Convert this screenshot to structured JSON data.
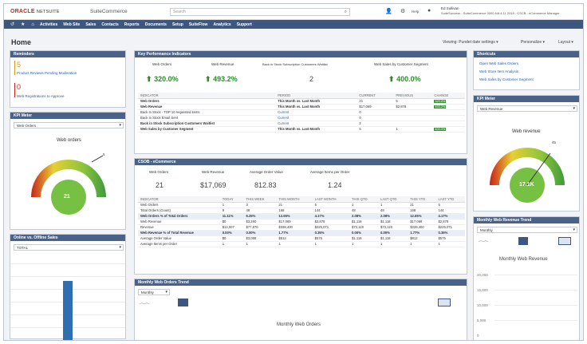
{
  "topbar": {
    "logo_oracle": "ORACLE",
    "logo_netsuite": "NETSUITE",
    "brand": "SuiteCommerce",
    "search_placeholder": "Search",
    "help": "Help",
    "user_name": "Ed Sullivan",
    "user_role": "SuiteSuccess - SuiteCommerce 0000-NA 4.11.2018 - CSCB - eCommerce Manager"
  },
  "nav": {
    "items": [
      "Activities",
      "Web Site",
      "Sales",
      "Contacts",
      "Reports",
      "Documents",
      "Setup",
      "SuiteFlow",
      "Analytics",
      "Support"
    ]
  },
  "page": {
    "title": "Home",
    "viewing": "Viewing: Pundet date settings",
    "personalize": "Personalize",
    "layout": "Layout"
  },
  "reminders": {
    "title": "Reminders",
    "items": [
      {
        "count": "5",
        "label": "Product Reviews Pending Moderation"
      },
      {
        "count": "0",
        "label": "Web Registrations to Approve"
      }
    ]
  },
  "kpi_meter_left": {
    "title": "KPI Meter",
    "select": "Web Orders",
    "gauge_title": "Web orders",
    "value": "21",
    "max": "5"
  },
  "online_offline": {
    "title": "Online vs. Offline Sales",
    "select": "TOTAL",
    "yticks": [
      "",
      "",
      "",
      "",
      "",
      "",
      ""
    ]
  },
  "kpi": {
    "title": "Key Performance Indicators",
    "headlines": [
      {
        "label": "Web Orders",
        "value": "320.0%"
      },
      {
        "label": "Web Revenue",
        "value": "493.2%"
      },
      {
        "label": "Back in Stock Subscription Customers Waitlist",
        "value": "2"
      },
      {
        "label": "Web Sales by Customer Segment",
        "value": "400.0%"
      }
    ],
    "columns": [
      "INDICATOR",
      "PERIOD",
      "CURRENT",
      "PREVIOUS",
      "CHANGE"
    ],
    "rows": [
      {
        "indicator": "Web Orders",
        "period": "This Month vs. Last Month",
        "current": "21",
        "previous": "5",
        "change": "320.0%"
      },
      {
        "indicator": "Web Revenue",
        "period": "This Month vs. Last Month",
        "current": "$17,069",
        "previous": "$2,878",
        "change": "493.2%"
      },
      {
        "indicator": "Back In Stock - TOP 10 requested items",
        "period": "Current",
        "current": "0",
        "previous": "",
        "change": ""
      },
      {
        "indicator": "Back In Stock Email Sent",
        "period": "Current",
        "current": "0",
        "previous": "",
        "change": ""
      },
      {
        "indicator": "Back in Stock Subscription Customers Waitlist",
        "period": "Current",
        "current": "2",
        "previous": "",
        "change": ""
      },
      {
        "indicator": "Web Sales by Customer Segment",
        "period": "This Month vs. Last Month",
        "current": "5",
        "previous": "1",
        "change": "400.0%"
      }
    ]
  },
  "csob": {
    "title": "CSOB - eCommerce",
    "headlines": [
      {
        "label": "Web Orders",
        "value": "21"
      },
      {
        "label": "Web Revenue",
        "value": "$17,069"
      },
      {
        "label": "Average Order Value",
        "value": "812.83"
      },
      {
        "label": "Average Items per Order",
        "value": "1.24"
      }
    ],
    "columns": [
      "INDICATOR",
      "TODAY",
      "THIS WEEK",
      "THIS MONTH",
      "LAST MONTH",
      "THIS QTD",
      "LAST QTD",
      "THIS YTD",
      "LAST YTD"
    ],
    "rows": [
      {
        "cells": [
          "Web Orders",
          "1",
          "3",
          "21",
          "5",
          "1",
          "1",
          "21",
          "5"
        ],
        "hl": false
      },
      {
        "cells": [
          "Total Orders (Count)",
          "9",
          "48",
          "168",
          "144",
          "48",
          "48",
          "168",
          "144"
        ],
        "hl": false
      },
      {
        "cells": [
          "Web Orders % of Total Orders",
          "11.11%",
          "6.25%",
          "12.65%",
          "4.17%",
          "2.08%",
          "2.08%",
          "12.65%",
          "4.17%"
        ],
        "hl": true
      },
      {
        "cells": [
          "Web Revenue",
          "$0",
          "$3,260",
          "$17,069",
          "$2,878",
          "$1,118",
          "$1,118",
          "$17,069",
          "$2,878"
        ],
        "hl": false
      },
      {
        "cells": [
          "Revenue",
          "$14,007",
          "$77,870",
          "$339,400",
          "$225,071",
          "$73,119",
          "$73,119",
          "$339,400",
          "$225,071"
        ],
        "hl": false
      },
      {
        "cells": [
          "Web Revenue % of Total Revenue",
          "0.00%",
          "0.00%",
          "1.77%",
          "0.35%",
          "0.00%",
          "0.00%",
          "1.77%",
          "0.35%"
        ],
        "hl": true
      },
      {
        "cells": [
          "Average Order Value",
          "$0",
          "$3,088",
          "$812",
          "$575",
          "$1,118",
          "$1,118",
          "$812",
          "$575"
        ],
        "hl": false
      },
      {
        "cells": [
          "Average Items per Order",
          "1",
          "1",
          "1",
          "1",
          "1",
          "1",
          "1",
          "1"
        ],
        "hl": false
      }
    ]
  },
  "monthly_orders": {
    "title": "Monthly Web Orders Trend",
    "select": "Monthly",
    "chart_title": "Monthly Web Orders"
  },
  "shortcuts": {
    "title": "Shortcuts",
    "items": [
      "Open Web Sales Orders",
      "Web Store Item Analysis",
      "Web Sales by Customer Segment"
    ]
  },
  "kpi_meter_right": {
    "title": "KPI Meter",
    "select": "Web Revenue",
    "gauge_title": "Web revenue",
    "value": "17.1K",
    "max": "45"
  },
  "monthly_revenue": {
    "title": "Monthly Web Revenue Trend",
    "select": "Monthly",
    "chart_title": "Monthly Web Revenue",
    "yticks": [
      "20,000",
      "15,000",
      "10,000",
      "5,000",
      "0"
    ]
  },
  "colors": {
    "nav": "#3d5780",
    "portlet_header": "#4a6287",
    "green": "#2d8a2d",
    "accent": "#c7261b"
  }
}
